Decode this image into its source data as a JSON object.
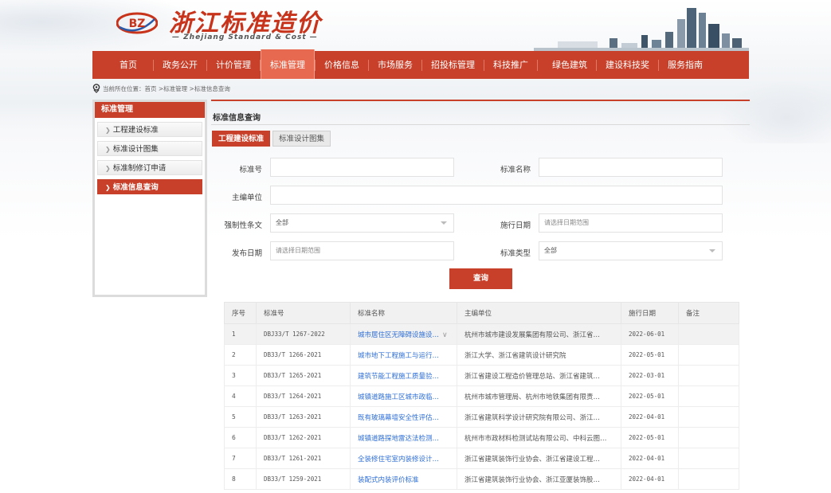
{
  "header": {
    "logo_badge": "BZ",
    "logo_cn": "浙江标准造价",
    "logo_en": "— Zhejiang Standard & Cost —"
  },
  "nav": {
    "items": [
      "首页",
      "政务公开",
      "计价管理",
      "标准管理",
      "价格信息",
      "市场服务",
      "招投标管理",
      "科技推广",
      "绿色建筑",
      "建设科技奖",
      "服务指南"
    ],
    "active_index": 3
  },
  "breadcrumb": {
    "prefix": "当前所在位置：",
    "path": "首页 >标准管理 >标准信息查询"
  },
  "sidebar": {
    "title": "标准管理",
    "items": [
      "工程建设标准",
      "标准设计图集",
      "标准制修订申请",
      "标准信息查询"
    ],
    "active_index": 3
  },
  "main": {
    "title": "标准信息查询",
    "tabs": [
      "工程建设标准",
      "标准设计图集"
    ],
    "active_tab": 0
  },
  "form": {
    "std_no_label": "标准号",
    "std_no_value": "",
    "std_name_label": "标准名称",
    "std_name_value": "",
    "editor_label": "主编单位",
    "editor_value": "",
    "mandatory_label": "强制性条文",
    "mandatory_value": "全部",
    "impl_date_label": "施行日期",
    "impl_date_placeholder": "请选择日期范围",
    "pub_date_label": "发布日期",
    "pub_date_placeholder": "请选择日期范围",
    "std_type_label": "标准类型",
    "std_type_value": "全部",
    "query_button": "查询"
  },
  "table": {
    "headers": [
      "序号",
      "标准号",
      "标准名称",
      "主编单位",
      "施行日期",
      "备注"
    ],
    "rows": [
      {
        "no": "1",
        "code": "DBJ33/T 1267-2022",
        "name": "城市居住区无障碍设施设…",
        "unit": "杭州市城市建设发展集团有限公司、浙江省…",
        "date": "2022-06-01",
        "note": ""
      },
      {
        "no": "2",
        "code": "DB33/T 1266-2021",
        "name": "城市地下工程施工与运行…",
        "unit": "浙江大学、浙江省建筑设计研究院",
        "date": "2022-05-01",
        "note": ""
      },
      {
        "no": "3",
        "code": "DB33/T 1265-2021",
        "name": "建筑节能工程施工质量验…",
        "unit": "浙江省建设工程造价管理总站、浙江省建筑…",
        "date": "2022-03-01",
        "note": ""
      },
      {
        "no": "4",
        "code": "DB33/T 1264-2021",
        "name": "城镇道路施工区城市政临…",
        "unit": "杭州市城市管理局、杭州市地铁集团有限责…",
        "date": "2022-05-01",
        "note": ""
      },
      {
        "no": "5",
        "code": "DB33/T 1263-2021",
        "name": "既有玻璃幕墙安全性评估…",
        "unit": "浙江省建筑科学设计研究院有限公司、浙江…",
        "date": "2022-04-01",
        "note": ""
      },
      {
        "no": "6",
        "code": "DB33/T 1262-2021",
        "name": "城镇道路探地雷达法检测…",
        "unit": "杭州市市政材料检测试站有限公司、中科云图…",
        "date": "2022-05-01",
        "note": ""
      },
      {
        "no": "7",
        "code": "DB33/T 1261-2021",
        "name": "全装修住宅室内装修设计…",
        "unit": "浙江省建筑装饰行业协会、浙江省建设工程…",
        "date": "2022-04-01",
        "note": ""
      },
      {
        "no": "8",
        "code": "DB33/T 1259-2021",
        "name": "装配式内装评价标准",
        "unit": "浙江省建筑装饰行业协会、浙江亚厦装饰股…",
        "date": "2022-04-01",
        "note": ""
      }
    ]
  },
  "colors": {
    "brand_red": "#c8402a",
    "link_blue": "#2f6fd6"
  }
}
